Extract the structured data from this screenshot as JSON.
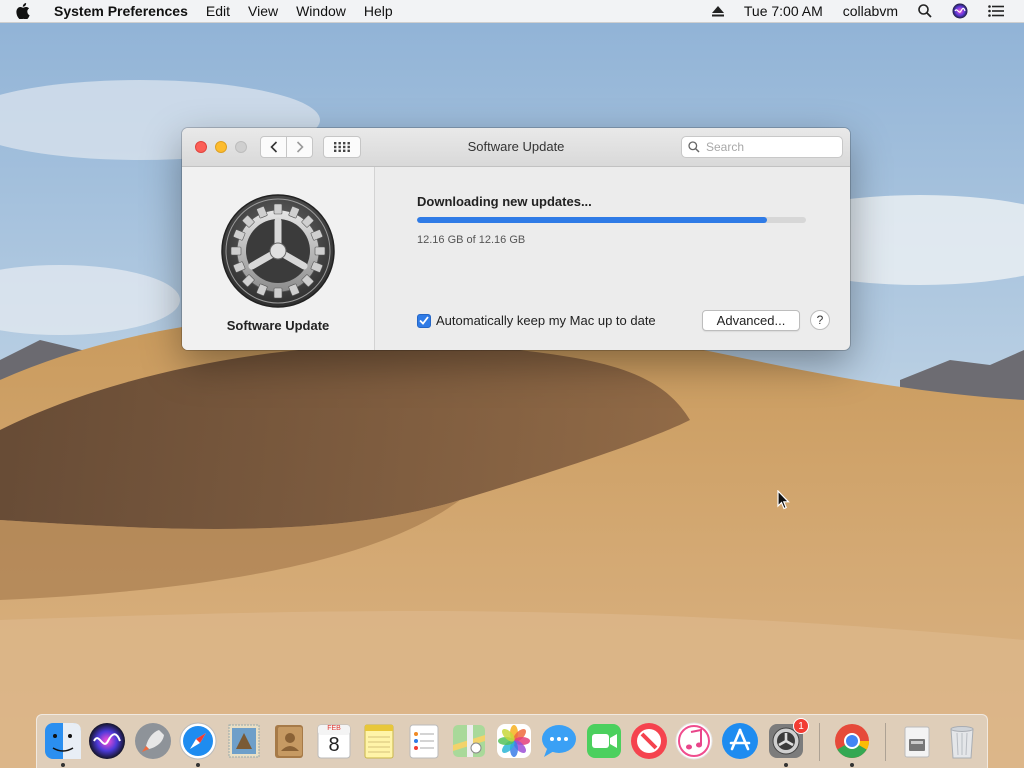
{
  "menubar": {
    "app_name": "System Preferences",
    "menus": [
      "Edit",
      "View",
      "Window",
      "Help"
    ],
    "clock": "Tue 7:00 AM",
    "user": "collabvm"
  },
  "window": {
    "title": "Software Update",
    "search_placeholder": "Search",
    "sidebar_label": "Software Update",
    "status_title": "Downloading new updates...",
    "progress_fraction": 0.9,
    "progress_text": "12.16 GB of 12.16 GB",
    "auto_update_label": "Automatically keep my Mac up to date",
    "auto_update_checked": true,
    "advanced_label": "Advanced...",
    "help_label": "?"
  },
  "dock": {
    "badge_count": "1",
    "calendar_month": "FEB",
    "calendar_day": "8",
    "icons": [
      "finder-icon",
      "siri-icon",
      "launchpad-icon",
      "safari-icon",
      "mail-icon",
      "contacts-icon",
      "calendar-icon",
      "notes-icon",
      "reminders-icon",
      "maps-icon",
      "photos-icon",
      "messages-icon",
      "facetime-icon",
      "news-icon",
      "itunes-icon",
      "app-store-icon",
      "system-preferences-icon",
      "chrome-icon",
      "downloads-stack-icon",
      "trash-icon"
    ]
  },
  "colors": {
    "accent": "#2f7be6",
    "close": "#fc5f57",
    "minimize": "#fdbc2e"
  }
}
